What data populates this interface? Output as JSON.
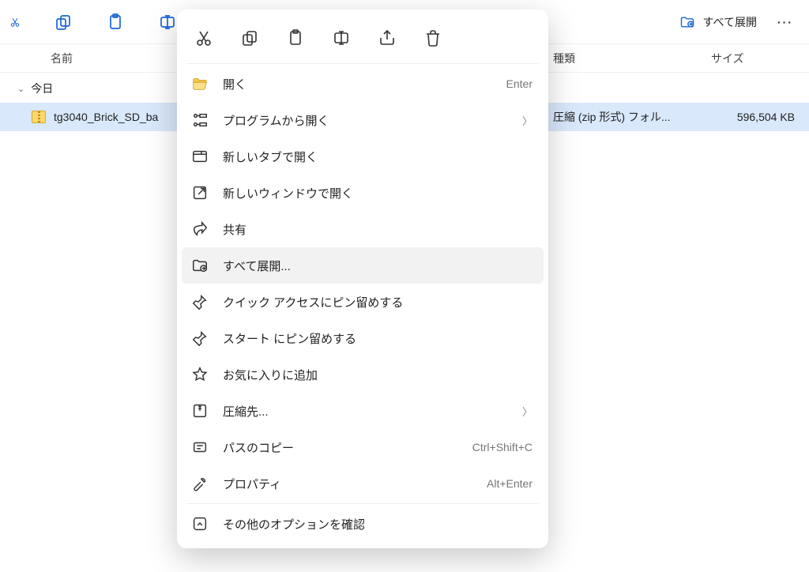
{
  "toolbar": {
    "expand_all_label": "すべて展開",
    "more": "···"
  },
  "columns": {
    "name": "名前",
    "type": "種類",
    "size": "サイズ"
  },
  "group_today": "今日",
  "file": {
    "name": "tg3040_Brick_SD_ba",
    "type": "圧縮 (zip 形式) フォル...",
    "size": "596,504 KB"
  },
  "menu": {
    "open": "開く",
    "open_acc": "Enter",
    "open_with": "プログラムから開く",
    "new_tab": "新しいタブで開く",
    "new_window": "新しいウィンドウで開く",
    "share": "共有",
    "extract_all": "すべて展開...",
    "pin_quick": "クイック アクセスにピン留めする",
    "pin_start": "スタート にピン留めする",
    "add_fav": "お気に入りに追加",
    "compress_to": "圧縮先...",
    "copy_path": "パスのコピー",
    "copy_path_acc": "Ctrl+Shift+C",
    "properties": "プロパティ",
    "properties_acc": "Alt+Enter",
    "more_options": "その他のオプションを確認"
  }
}
